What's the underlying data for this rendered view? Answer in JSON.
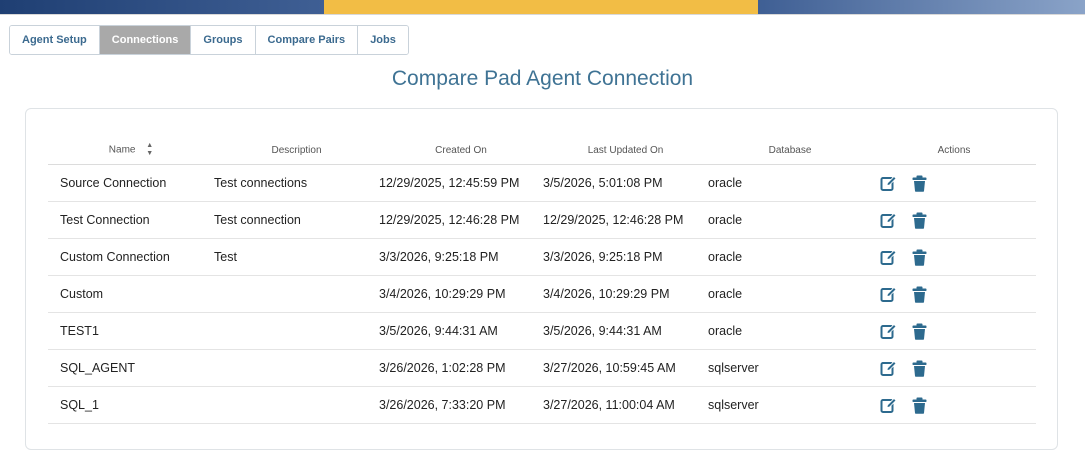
{
  "tabs": [
    {
      "label": "Agent Setup",
      "active": false
    },
    {
      "label": "Connections",
      "active": true
    },
    {
      "label": "Groups",
      "active": false
    },
    {
      "label": "Compare Pairs",
      "active": false
    },
    {
      "label": "Jobs",
      "active": false
    }
  ],
  "page": {
    "title": "Compare Pad Agent Connection"
  },
  "table": {
    "headers": {
      "name": "Name",
      "description": "Description",
      "created_on": "Created On",
      "last_updated_on": "Last Updated On",
      "database": "Database",
      "actions": "Actions"
    },
    "rows": [
      {
        "name": "Source Connection",
        "description": "Test connections",
        "created_on": "12/29/2025, 12:45:59 PM",
        "last_updated_on": "3/5/2026, 5:01:08 PM",
        "database": "oracle"
      },
      {
        "name": "Test Connection",
        "description": "Test connection",
        "created_on": "12/29/2025, 12:46:28 PM",
        "last_updated_on": "12/29/2025, 12:46:28 PM",
        "database": "oracle"
      },
      {
        "name": "Custom Connection",
        "description": "Test",
        "created_on": "3/3/2026, 9:25:18 PM",
        "last_updated_on": "3/3/2026, 9:25:18 PM",
        "database": "oracle"
      },
      {
        "name": "Custom",
        "description": "",
        "created_on": "3/4/2026, 10:29:29 PM",
        "last_updated_on": "3/4/2026, 10:29:29 PM",
        "database": "oracle"
      },
      {
        "name": "TEST1",
        "description": "",
        "created_on": "3/5/2026, 9:44:31 AM",
        "last_updated_on": "3/5/2026, 9:44:31 AM",
        "database": "oracle"
      },
      {
        "name": "SQL_AGENT",
        "description": "",
        "created_on": "3/26/2026, 1:02:28 PM",
        "last_updated_on": "3/27/2026, 10:59:45 AM",
        "database": "sqlserver"
      },
      {
        "name": "SQL_1",
        "description": "",
        "created_on": "3/26/2026, 7:33:20 PM",
        "last_updated_on": "3/27/2026, 11:00:04 AM",
        "database": "sqlserver"
      }
    ]
  },
  "icons": {
    "edit": "edit-icon",
    "delete": "trash-icon",
    "sort": "sort-icon"
  },
  "colors": {
    "accent": "#3f7394",
    "icon": "#2d6a8e",
    "tab_active_bg": "#a9a9a9",
    "bar_gold": "#f2bd45",
    "bar_blue": "#1f3f73"
  }
}
